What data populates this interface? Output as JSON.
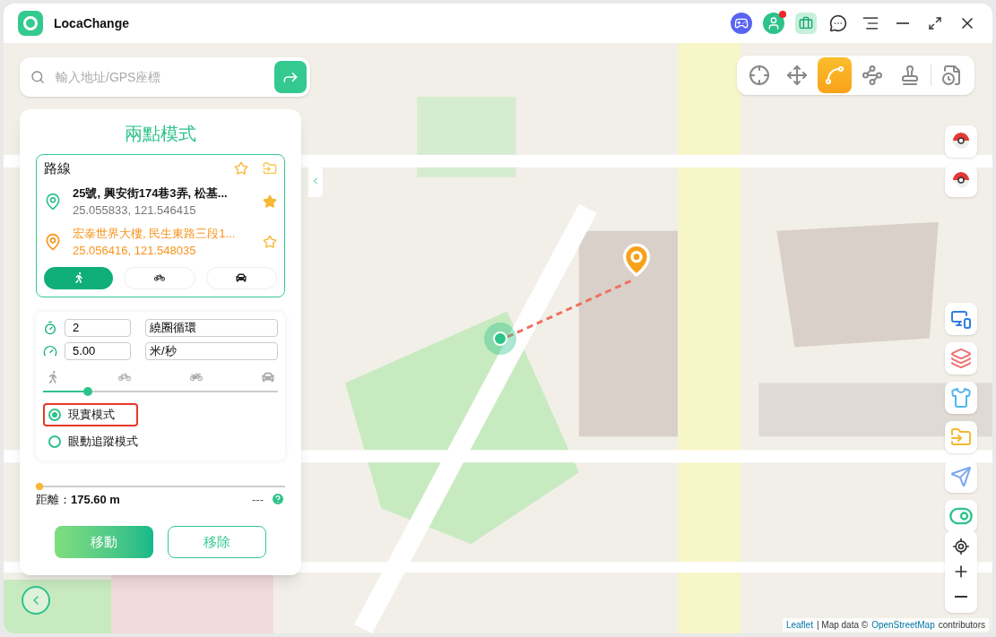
{
  "app": {
    "title": "LocaChange"
  },
  "search": {
    "placeholder": "輸入地址/GPS座標"
  },
  "toolbar": [
    {
      "kind": "teleport",
      "selected": false
    },
    {
      "kind": "joystick",
      "selected": false
    },
    {
      "kind": "two-spot",
      "selected": true
    },
    {
      "kind": "multi-spot",
      "selected": false
    },
    {
      "kind": "jump",
      "selected": false
    },
    {
      "kind": "history",
      "selected": false
    }
  ],
  "panel": {
    "title": "兩點模式",
    "route": {
      "label": "路線",
      "points": [
        {
          "kind": "start",
          "name": "25號, 興安街174巷3弄, 松基...",
          "coords": "25.055833, 121.546415",
          "favorite": true
        },
        {
          "kind": "end",
          "name": "宏泰世界大樓, 民生東路三段1...",
          "coords": "25.056416, 121.548035",
          "favorite": false
        }
      ]
    },
    "transport": [
      {
        "kind": "walk",
        "selected": true
      },
      {
        "kind": "bike",
        "selected": false
      },
      {
        "kind": "car",
        "selected": false
      }
    ],
    "repeat_count": "2",
    "loop_mode": "繞圈循環",
    "speed": "5.00",
    "speed_unit": "米/秒",
    "speed_slider": {
      "level": 0.19
    },
    "modes": [
      {
        "label": "現實模式",
        "selected": true,
        "highlighted": true
      },
      {
        "label": "眼動追蹤模式",
        "selected": false,
        "highlighted": false
      }
    ],
    "progress": {
      "level": 0
    },
    "distance_label": "距離：",
    "distance": "175.60 m",
    "eta": "---",
    "buttons": [
      {
        "kind": "primary",
        "label": "移動"
      },
      {
        "kind": "secondary",
        "label": "移除"
      }
    ]
  },
  "side_tools": [
    {
      "kind": "pokeball"
    },
    {
      "kind": "pokeball-pin"
    },
    {
      "kind": "devices"
    },
    {
      "kind": "cards"
    },
    {
      "kind": "shirt"
    },
    {
      "kind": "folder"
    },
    {
      "kind": "send"
    },
    {
      "kind": "toggle"
    }
  ],
  "attribution": {
    "link1": "Leaflet",
    "separator": "| Map data ©",
    "link2": "OpenStreetMap",
    "suffix": "contributors"
  }
}
